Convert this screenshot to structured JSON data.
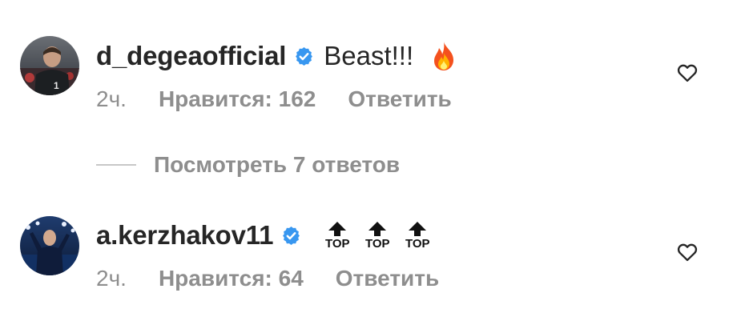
{
  "comments": [
    {
      "username": "d_degeaofficial",
      "text": "Beast!!!",
      "emoji_icon": "fire-icon",
      "time": "2ч.",
      "likes": "Нравится: 162",
      "reply": "Ответить",
      "verified": true
    },
    {
      "username": "a.kerzhakov11",
      "text": "",
      "top_emojis": [
        "TOP",
        "TOP",
        "TOP"
      ],
      "time": "2ч.",
      "likes": "Нравится: 64",
      "reply": "Ответить",
      "verified": true
    }
  ],
  "view_replies": "Посмотреть 7 ответов",
  "colors": {
    "text": "#262626",
    "muted": "#8e8e8e",
    "verified": "#3897f0",
    "divider": "#c7c7c7"
  }
}
